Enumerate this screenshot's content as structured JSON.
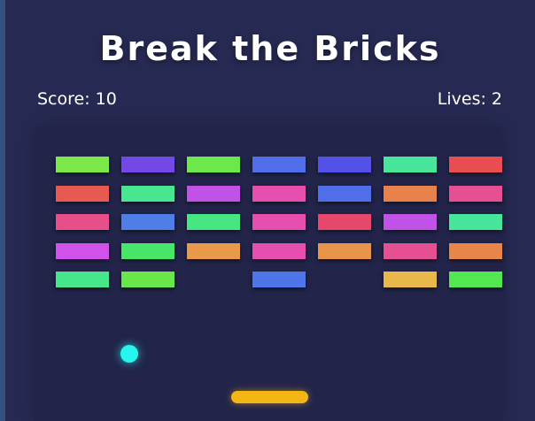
{
  "game": {
    "title": "Break the Bricks",
    "score_label": "Score: 10",
    "lives_label": "Lives: 2"
  },
  "colors": {
    "background": "#262a52",
    "board": "#22244a",
    "ball": "#27f5ee",
    "paddle": "#f4b614",
    "text": "#ffffff"
  },
  "bricks": [
    [
      "#7de84a",
      "#7448e4",
      "#6de84a",
      "#4f6ee8",
      "#5251e8",
      "#48e69a",
      "#e84d52"
    ],
    [
      "#e65a52",
      "#48e68e",
      "#c152e8",
      "#e64fb0",
      "#4f6ee8",
      "#e8824a",
      "#e64f92"
    ],
    [
      "#e64f8a",
      "#4f7ee8",
      "#48e682",
      "#e64fb0",
      "#e6486c",
      "#c152e8",
      "#48e69a"
    ],
    [
      "#d152e8",
      "#48e668",
      "#e89a4a",
      "#e64fb0",
      "#e8944a",
      "#e64f92",
      "#e8864a"
    ],
    [
      "#48e68a",
      "#68e64a",
      null,
      "#4f76e8",
      null,
      "#e8b84a",
      "#52e852"
    ]
  ]
}
